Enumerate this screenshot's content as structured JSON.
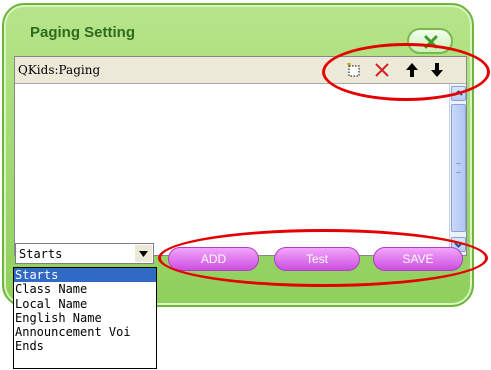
{
  "dialog": {
    "title": "Paging Setting",
    "close_icon": "close-x-icon"
  },
  "panel": {
    "header_label": "QKids:Paging",
    "tools": [
      "new-item-icon",
      "delete-icon",
      "move-up-icon",
      "move-down-icon"
    ]
  },
  "dropdown": {
    "selected": "Starts",
    "options": [
      "Starts",
      "Class Name",
      "Local Name",
      "English Name",
      "Announcement Voi",
      "Ends"
    ]
  },
  "buttons": {
    "add": "ADD",
    "test": "Test",
    "save": "SAVE"
  },
  "colors": {
    "dialog_bg": "#9bd56c",
    "button": "#d864eb",
    "highlight_ring": "#e40000",
    "selection": "#316ac5"
  }
}
